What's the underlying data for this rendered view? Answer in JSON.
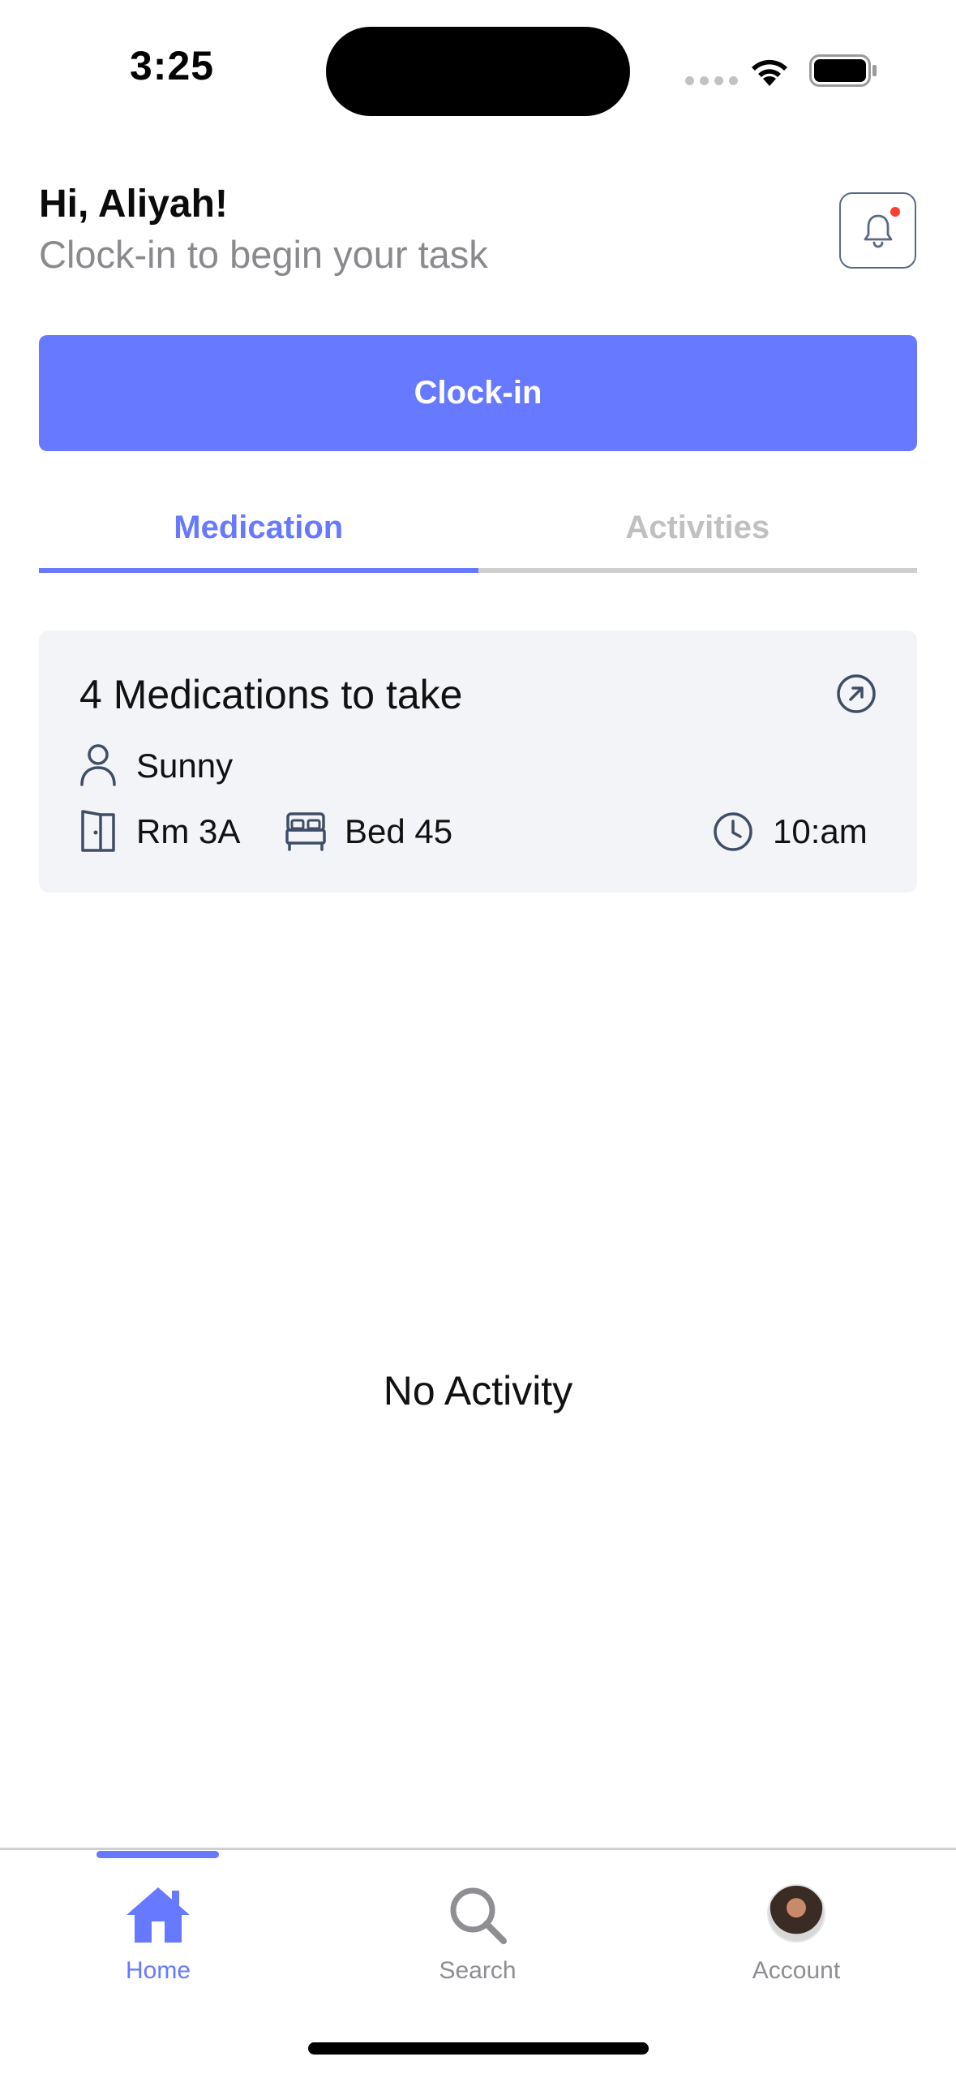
{
  "status_bar": {
    "time": "3:25"
  },
  "header": {
    "greeting": "Hi, Aliyah!",
    "subtitle": "Clock-in to begin your task"
  },
  "clock_in_button": {
    "label": "Clock-in"
  },
  "tabs": [
    {
      "label": "Medication",
      "active": true
    },
    {
      "label": "Activities",
      "active": false
    }
  ],
  "medication_card": {
    "title": "4 Medications to take",
    "patient": "Sunny",
    "room": "Rm 3A",
    "bed": "Bed 45",
    "time": "10:am"
  },
  "empty_state": {
    "text": "No Activity"
  },
  "bottom_nav": [
    {
      "label": "Home",
      "icon": "home-icon",
      "active": true
    },
    {
      "label": "Search",
      "icon": "search-icon",
      "active": false
    },
    {
      "label": "Account",
      "icon": "avatar",
      "active": false
    }
  ],
  "colors": {
    "accent": "#6679ff",
    "inactive": "#c0c0c0",
    "card_bg": "#f3f4f8",
    "icon_slate": "#5b6a82",
    "notification_dot": "#ff3b30"
  }
}
